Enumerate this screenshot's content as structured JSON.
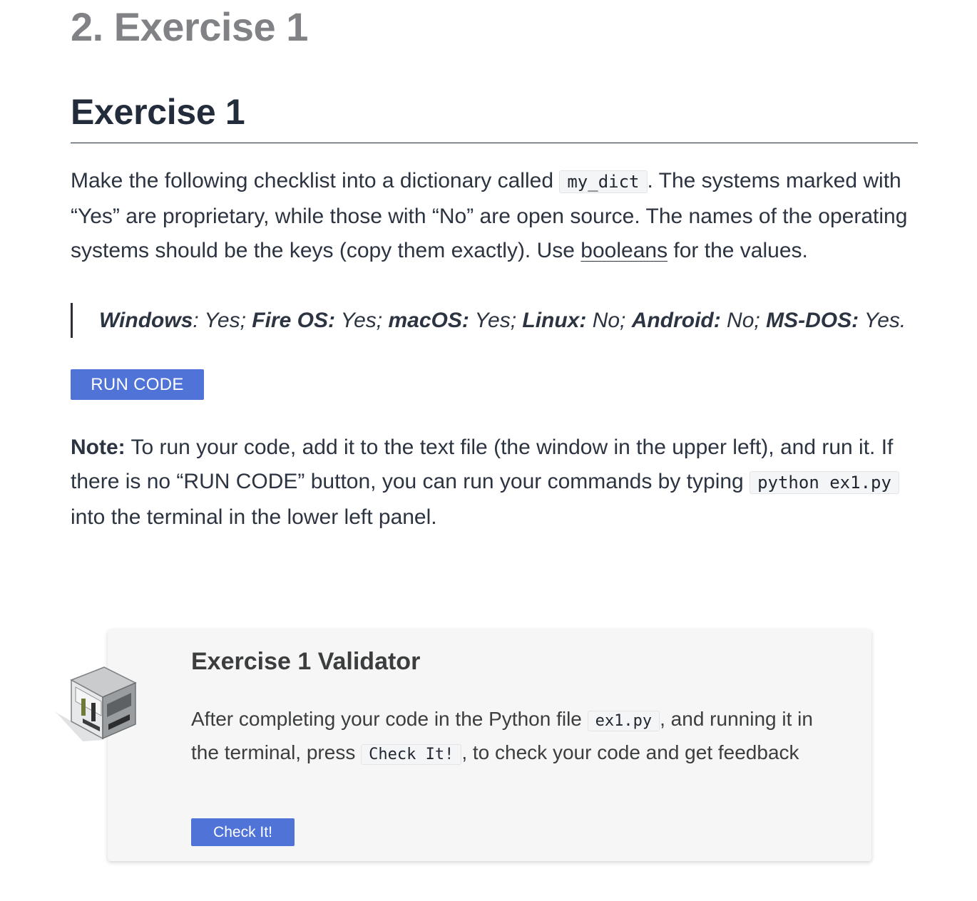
{
  "section": {
    "title": "2. Exercise 1"
  },
  "exercise": {
    "heading": "Exercise 1",
    "intro": {
      "p1": "Make the following checklist into a dictionary called ",
      "code1": "my_dict",
      "p2": ". The systems marked with “Yes” are proprietary, while those with “No” are open source. The names of the operating systems should be the keys (copy them exactly). Use ",
      "link": "booleans",
      "p3": " for the values."
    },
    "checklist": [
      {
        "name": "Windows",
        "sep": ":",
        "value": " Yes;"
      },
      {
        "name": "Fire OS:",
        "sep": "",
        "value": " Yes;"
      },
      {
        "name": "macOS:",
        "sep": "",
        "value": " Yes;"
      },
      {
        "name": "Linux:",
        "sep": "",
        "value": " No;"
      },
      {
        "name": "Android:",
        "sep": "",
        "value": " No;"
      },
      {
        "name": "MS-DOS:",
        "sep": "",
        "value": " Yes."
      }
    ],
    "run_button": "RUN CODE",
    "note": {
      "label": "Note:",
      "t1": " To run your code, add it to the text file (the window in the upper left), and run it. If there is no “RUN CODE” button, you can run your commands by typing ",
      "code": "python ex1.py",
      "t2": " into the terminal in the lower left panel."
    }
  },
  "validator": {
    "icon": "validator-cube-icon",
    "title": "Exercise 1 Validator",
    "t1": "After completing your code in the Python file ",
    "code1": "ex1.py",
    "t2": ", and running it in the terminal, press ",
    "code2": "Check It!",
    "t3": ", to check your code and get feedback",
    "button": "Check It!"
  },
  "colors": {
    "accent": "#4f73d6",
    "panel_bg": "#f5f6f5"
  }
}
